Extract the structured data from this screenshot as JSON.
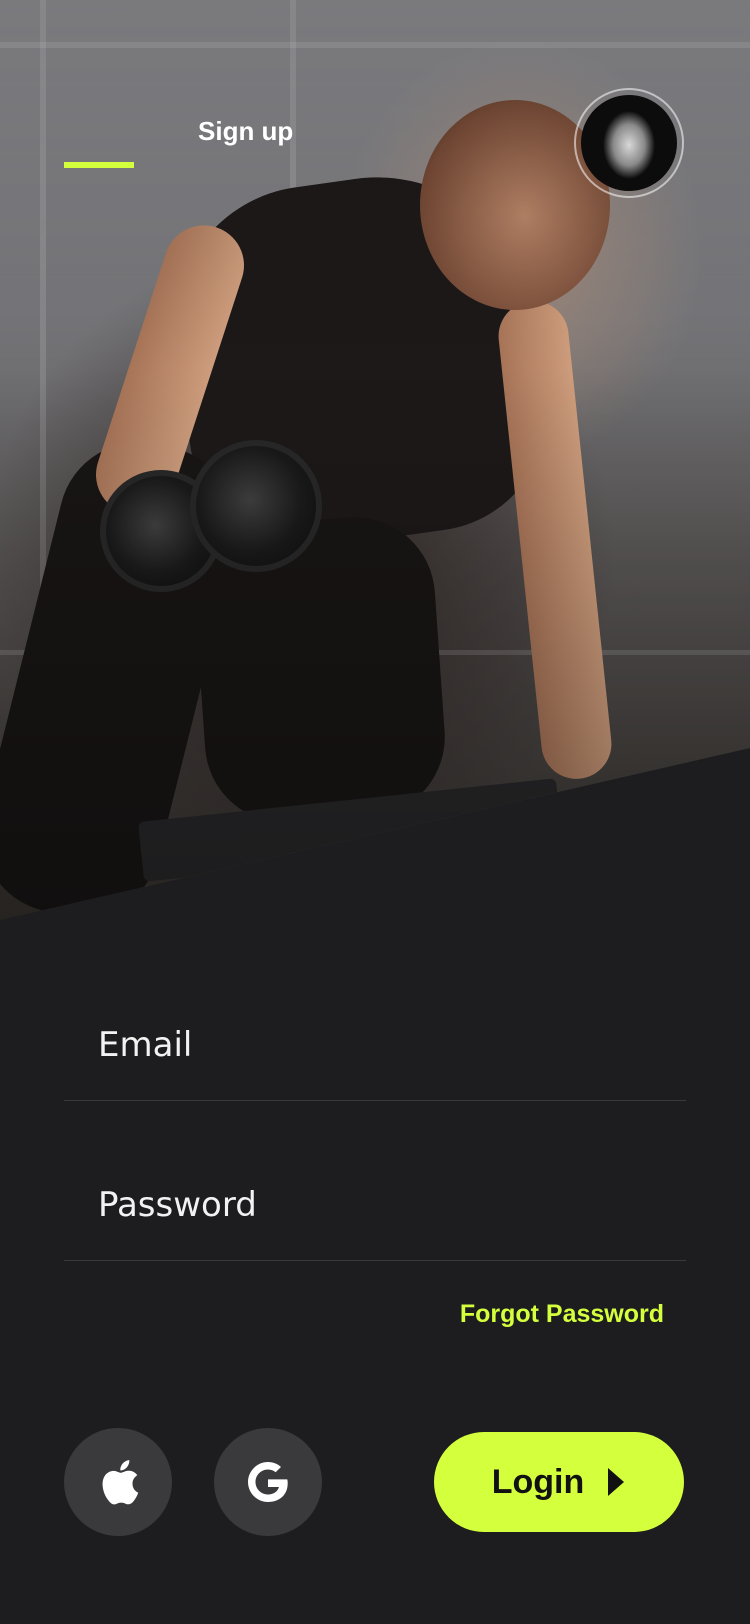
{
  "header": {
    "active_tab_indicator": "login",
    "signup_tab_label": "Sign up",
    "avatar_icon": "user-avatar"
  },
  "form": {
    "email": {
      "placeholder": "Email",
      "value": ""
    },
    "password": {
      "placeholder": "Password",
      "value": ""
    },
    "forgot_password_label": "Forgot Password"
  },
  "actions": {
    "apple_icon": "apple-icon",
    "google_icon": "google-icon",
    "login_label": "Login",
    "login_icon": "play-icon"
  },
  "colors": {
    "accent": "#d4ff3c",
    "background": "#1d1d1f",
    "social_button": "#3a3a3c"
  }
}
